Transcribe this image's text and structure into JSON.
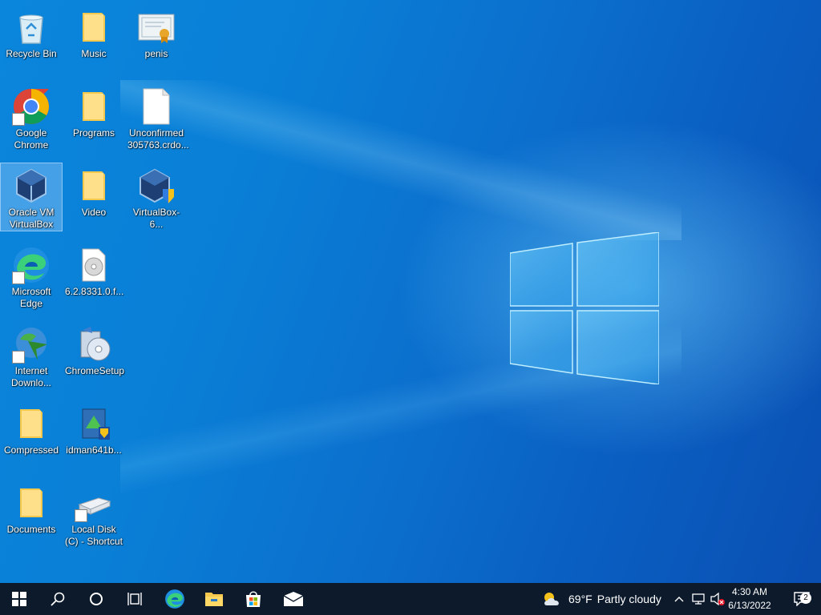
{
  "desktop": {
    "icons": [
      {
        "label": "Recycle Bin"
      },
      {
        "label": "Music"
      },
      {
        "label": "penis"
      },
      {
        "label": "Google Chrome"
      },
      {
        "label": "Programs"
      },
      {
        "label": "Unconfirmed 305763.crdo..."
      },
      {
        "label": "Oracle VM VirtualBox"
      },
      {
        "label": "Video"
      },
      {
        "label": "VirtualBox-6..."
      },
      {
        "label": "Microsoft Edge"
      },
      {
        "label": "6.2.8331.0.f..."
      },
      {
        "label": "Internet Downlo..."
      },
      {
        "label": "ChromeSetup"
      },
      {
        "label": "Compressed"
      },
      {
        "label": "idman641b..."
      },
      {
        "label": "Documents"
      },
      {
        "label": "Local Disk (C) - Shortcut"
      }
    ]
  },
  "taskbar": {
    "weather_temp": "69°F",
    "weather_desc": "Partly cloudy",
    "time": "4:30 AM",
    "date": "6/13/2022",
    "notification_count": "2",
    "pinned": [
      "start-icon",
      "search-icon",
      "cortana-icon",
      "task-view-icon",
      "edge-icon",
      "file-explorer-icon",
      "store-icon",
      "mail-icon"
    ]
  },
  "colors": {
    "taskbar_bg": "#0c1a2b",
    "desktop_blue": "#0a7fd6"
  }
}
